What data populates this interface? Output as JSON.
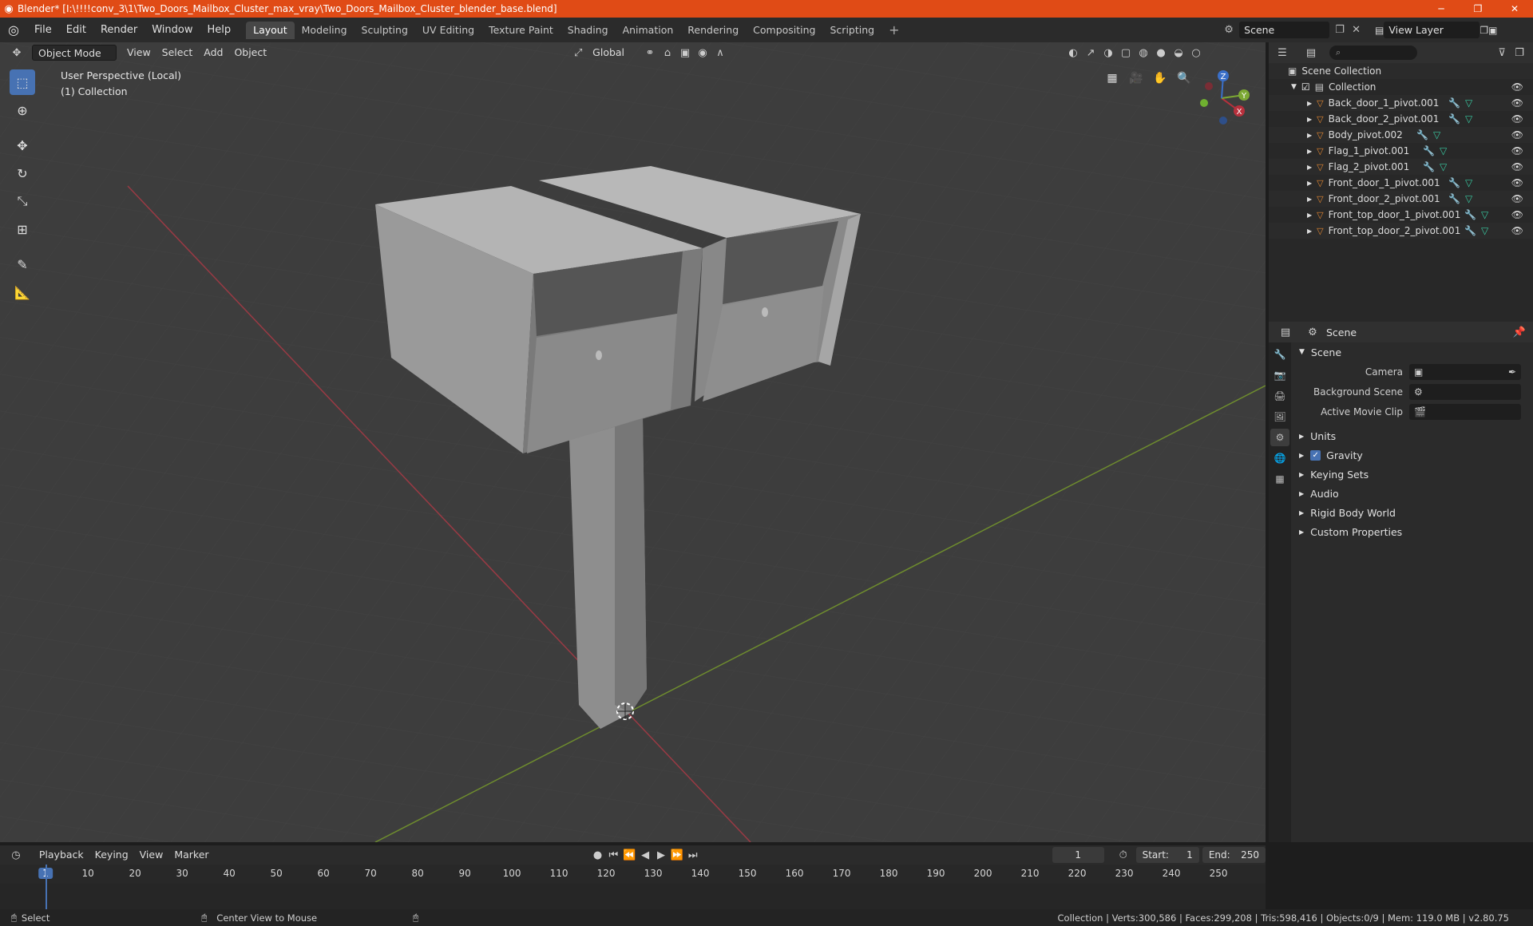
{
  "window": {
    "title": "Blender* [I:\\!!!!conv_3\\1\\Two_Doors_Mailbox_Cluster_max_vray\\Two_Doors_Mailbox_Cluster_blender_base.blend]",
    "minimize": "─",
    "restore": "❐",
    "close": "✕"
  },
  "menu": [
    "File",
    "Edit",
    "Render",
    "Window",
    "Help"
  ],
  "workspaces": [
    "Layout",
    "Modeling",
    "Sculpting",
    "UV Editing",
    "Texture Paint",
    "Shading",
    "Animation",
    "Rendering",
    "Compositing",
    "Scripting"
  ],
  "workspace_active": "Layout",
  "scene_name": "Scene",
  "view_layer": "View Layer",
  "viewport": {
    "mode": "Object Mode",
    "menus": [
      "View",
      "Select",
      "Add",
      "Object"
    ],
    "transform_orientation": "Global",
    "perspective_label": "User Perspective (Local)",
    "collection_label": "(1) Collection",
    "gizmo_axes": {
      "x": "X",
      "y": "Y",
      "z": "Z"
    }
  },
  "outliner": {
    "root": "Scene Collection",
    "collection": "Collection",
    "objects": [
      "Back_door_1_pivot.001",
      "Back_door_2_pivot.001",
      "Body_pivot.002",
      "Flag_1_pivot.001",
      "Flag_2_pivot.001",
      "Front_door_1_pivot.001",
      "Front_door_2_pivot.001",
      "Front_top_door_1_pivot.001",
      "Front_top_door_2_pivot.001"
    ]
  },
  "properties": {
    "header": "Scene",
    "section": "Scene",
    "fields": {
      "camera": "Camera",
      "background_scene": "Background Scene",
      "active_movie_clip": "Active Movie Clip"
    },
    "panels": {
      "units": "Units",
      "gravity": "Gravity",
      "keying_sets": "Keying Sets",
      "audio": "Audio",
      "rigid_body_world": "Rigid Body World",
      "custom_properties": "Custom Properties"
    },
    "gravity_enabled": true
  },
  "timeline": {
    "menus": [
      "Playback",
      "Keying",
      "View",
      "Marker"
    ],
    "current_frame": "1",
    "start_label": "Start:",
    "start": "1",
    "end_label": "End:",
    "end": "250",
    "ticks": [
      "1",
      "10",
      "20",
      "30",
      "40",
      "50",
      "60",
      "70",
      "80",
      "90",
      "100",
      "110",
      "120",
      "130",
      "140",
      "150",
      "160",
      "170",
      "180",
      "190",
      "200",
      "210",
      "220",
      "230",
      "240",
      "250"
    ]
  },
  "status": {
    "left": "Select",
    "middle": "Center View to Mouse",
    "right": "Collection | Verts:300,586 | Faces:299,208 | Tris:598,416 | Objects:0/9 | Mem: 119.0 MB | v2.80.75"
  },
  "colors": {
    "title_bar": "#e04b16",
    "accent": "#4772b3",
    "x_axis": "#b8303c",
    "y_axis": "#7ca834",
    "object_icon": "#e08530"
  }
}
